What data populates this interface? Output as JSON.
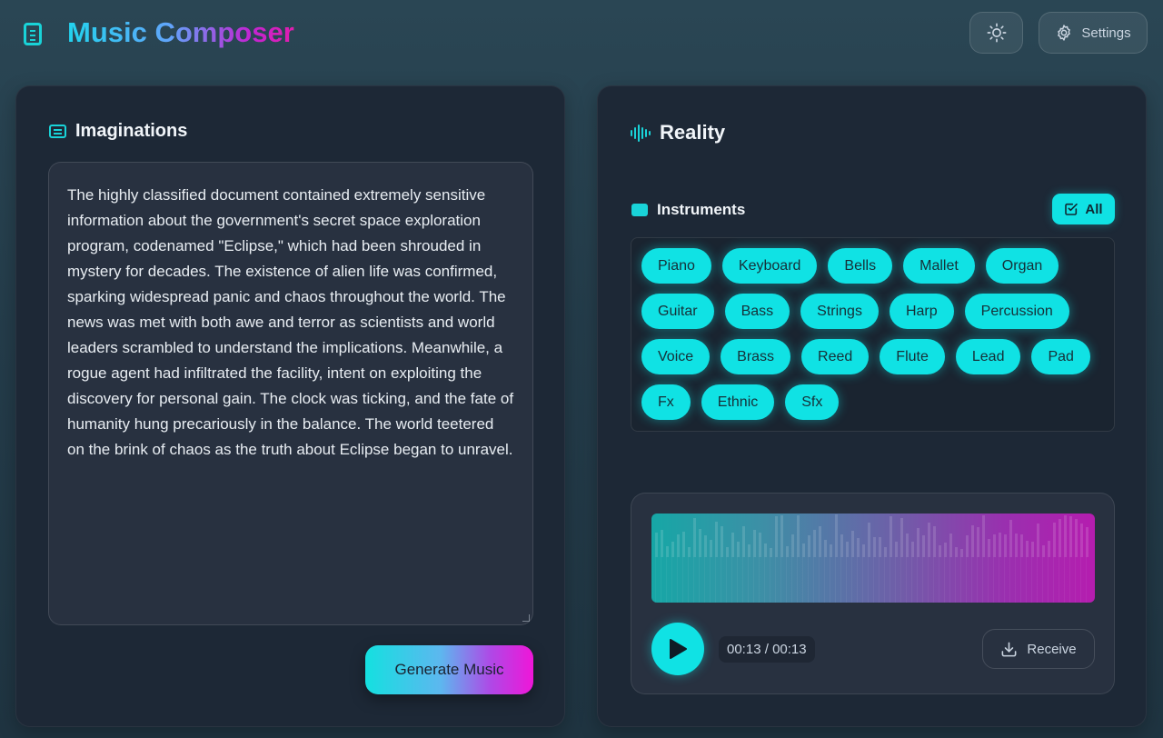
{
  "header": {
    "title": "Music Composer",
    "settings_label": "Settings"
  },
  "left": {
    "title": "Imaginations",
    "text": "The highly classified document contained extremely sensitive information about the government's secret space exploration program, codenamed \"Eclipse,\" which had been shrouded in mystery for decades. The existence of alien life was confirmed, sparking widespread panic and chaos throughout the world. The news was met with both awe and terror as scientists and world leaders scrambled to understand the implications. Meanwhile, a rogue agent had infiltrated the facility, intent on exploiting the discovery for personal gain. The clock was ticking, and the fate of humanity hung precariously in the balance. The world teetered on the brink of chaos as the truth about Eclipse began to unravel.",
    "generate_label": "Generate Music"
  },
  "right": {
    "title": "Reality",
    "instruments_label": "Instruments",
    "all_label": "All",
    "instruments": [
      "Piano",
      "Keyboard",
      "Bells",
      "Mallet",
      "Organ",
      "Guitar",
      "Bass",
      "Strings",
      "Harp",
      "Percussion",
      "Voice",
      "Brass",
      "Reed",
      "Flute",
      "Lead",
      "Pad",
      "Fx",
      "Ethnic",
      "Sfx"
    ],
    "player": {
      "current_time": "00:13",
      "total_time": "00:13",
      "receive_label": "Receive"
    }
  },
  "colors": {
    "accent": "#10e2e4",
    "panel": "#1d2836",
    "title_gradient_start": "#22d3ee",
    "title_gradient_end": "#e11dae"
  },
  "icons": {
    "logo": "document-icon",
    "theme": "sun-icon",
    "settings": "gear-icon",
    "imaginations": "textbox-icon",
    "reality": "audio-wave-icon",
    "instruments": "square-icon",
    "all": "checkbox-icon",
    "play": "play-icon",
    "receive": "download-icon"
  }
}
